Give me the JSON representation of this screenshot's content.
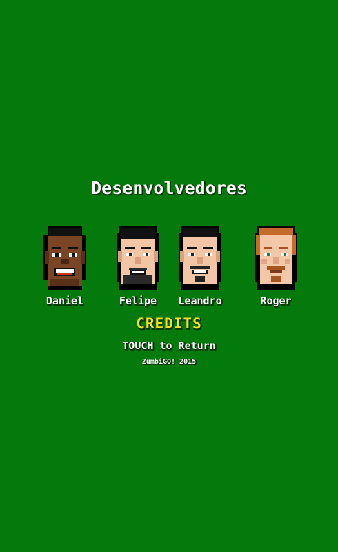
{
  "screen": {
    "title": "Desenvolvedores",
    "credits_label": "CREDITS",
    "return_label": "TOUCH to Return",
    "footer": "ZumbiGO! 2015"
  },
  "developers": [
    {
      "name": "Daniel",
      "skin": "#7a4524",
      "skin_shade": "#5a3018",
      "hair": "#111111",
      "beard": "none"
    },
    {
      "name": "Felipe",
      "skin": "#f2c6a5",
      "skin_shade": "#d9a27e",
      "hair": "#111111",
      "beard": "goatee"
    },
    {
      "name": "Leandro",
      "skin": "#f2c6a5",
      "skin_shade": "#d9a27e",
      "hair": "#111111",
      "beard": "goatee"
    },
    {
      "name": "Roger",
      "skin": "#f3c8a8",
      "skin_shade": "#dca586",
      "hair": "#c56a2a",
      "beard": "mustache"
    }
  ],
  "colors": {
    "background": "#057a0c",
    "credits": "#f2e21f",
    "text": "#ffffff"
  }
}
